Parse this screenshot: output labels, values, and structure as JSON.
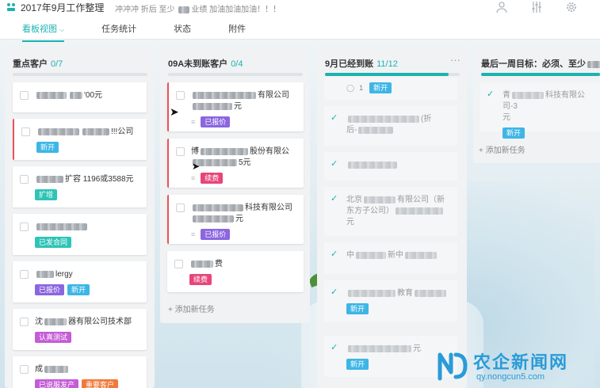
{
  "header": {
    "title": "2017年9月工作整理",
    "description": "冲冲冲 折后 至少 ",
    "description_tail": "业绩 加油加油加油！！！",
    "tabs": [
      {
        "label": "看板视图",
        "active": true
      },
      {
        "label": "任务统计",
        "active": false
      },
      {
        "label": "状态",
        "active": false
      },
      {
        "label": "附件",
        "active": false
      }
    ],
    "icons": [
      "user-icon",
      "filter-icon",
      "settings-icon"
    ]
  },
  "colors": {
    "accent": "#1bb3b0",
    "red_flag": "#e8545a",
    "tag_new": "#3db6e6",
    "tag_expand": "#2ec4b6",
    "tag_contracted": "#2ec4b6",
    "tag_quoted": "#8b66e0",
    "tag_renew": "#e8457a",
    "tag_testing": "#c45cd6",
    "tag_important": "#f07a3a"
  },
  "columns": [
    {
      "title": "重点客户",
      "count": "0/7",
      "cards": [
        {
          "pre": "",
          "text": "'00元",
          "tags": []
        },
        {
          "pre": "",
          "text": "!!!公司",
          "tags": [
            {
              "label": "新开",
              "color": "#3db6e6"
            }
          ]
        },
        {
          "pre": "",
          "text": "扩容 1196或3588元",
          "tags": [
            {
              "label": "扩增",
              "color": "#2ec4b6"
            }
          ]
        },
        {
          "pre": "",
          "text": "",
          "tags": [
            {
              "label": "已发合同",
              "color": "#2ec4b6"
            }
          ]
        },
        {
          "pre": "",
          "text": "lergy",
          "tags": [
            {
              "label": "已报价",
              "color": "#8b66e0"
            },
            {
              "label": "新开",
              "color": "#3db6e6"
            }
          ]
        },
        {
          "pre": "沈",
          "text": "器有限公司技术部",
          "tags": [
            {
              "label": "认真测试",
              "color": "#c45cd6"
            }
          ]
        },
        {
          "pre": "成",
          "text": "",
          "tags": [
            {
              "label": "已说服发产",
              "color": "#c45cd6"
            },
            {
              "label": "重要客户",
              "color": "#f07a3a"
            }
          ]
        }
      ]
    },
    {
      "title": "09A未到账客户",
      "count": "0/4",
      "cards": [
        {
          "pre": "",
          "text": "有限公司",
          "line2": "元",
          "tags": [
            {
              "label": "已报价",
              "color": "#8b66e0"
            }
          ]
        },
        {
          "pre": "博",
          "text": "股份有限公",
          "line2": "5元",
          "tags": [
            {
              "label": "续费",
              "color": "#e8457a"
            }
          ]
        },
        {
          "pre": "",
          "text": "科技有限公司",
          "line2": "元",
          "tags": [
            {
              "label": "已报价",
              "color": "#8b66e0"
            }
          ]
        },
        {
          "pre": "",
          "text": "费",
          "tags": [
            {
              "label": "续费",
              "color": "#e8457a"
            }
          ]
        }
      ],
      "add_task": "+ 添加新任务"
    },
    {
      "title": "9月已经到账",
      "count": "11/12",
      "progress": 0.92,
      "cards": [
        {
          "text": "",
          "comments": "1",
          "tags": [
            {
              "label": "新开",
              "color": "#3db6e6"
            }
          ]
        },
        {
          "text": "(折",
          "line2": "后-",
          "tags": []
        },
        {
          "text": "",
          "tags": []
        },
        {
          "text": "北京",
          "text_mid": "有限公司（新",
          "line2": "东方子公司）",
          "line3": "元",
          "tags": []
        },
        {
          "text": "中",
          "text_mid": "新中",
          "tags": []
        },
        {
          "text": "",
          "text_mid": "教育",
          "tags": [
            {
              "label": "新开",
              "color": "#3db6e6"
            }
          ]
        },
        {
          "text": "",
          "text_mid": "元",
          "tags": [
            {
              "label": "新开",
              "color": "#3db6e6"
            }
          ]
        }
      ]
    },
    {
      "title": "最后一周目标：必须、至少",
      "count": "",
      "cards": [
        {
          "text": "青",
          "text_mid": "科技有限公司-3",
          "line2": "元",
          "tags": [
            {
              "label": "新开",
              "color": "#3db6e6"
            }
          ]
        }
      ],
      "add_task": "+ 添加新任务"
    }
  ],
  "watermark": {
    "name": "农企新闻网",
    "url": "qy.nongcun5.com"
  }
}
